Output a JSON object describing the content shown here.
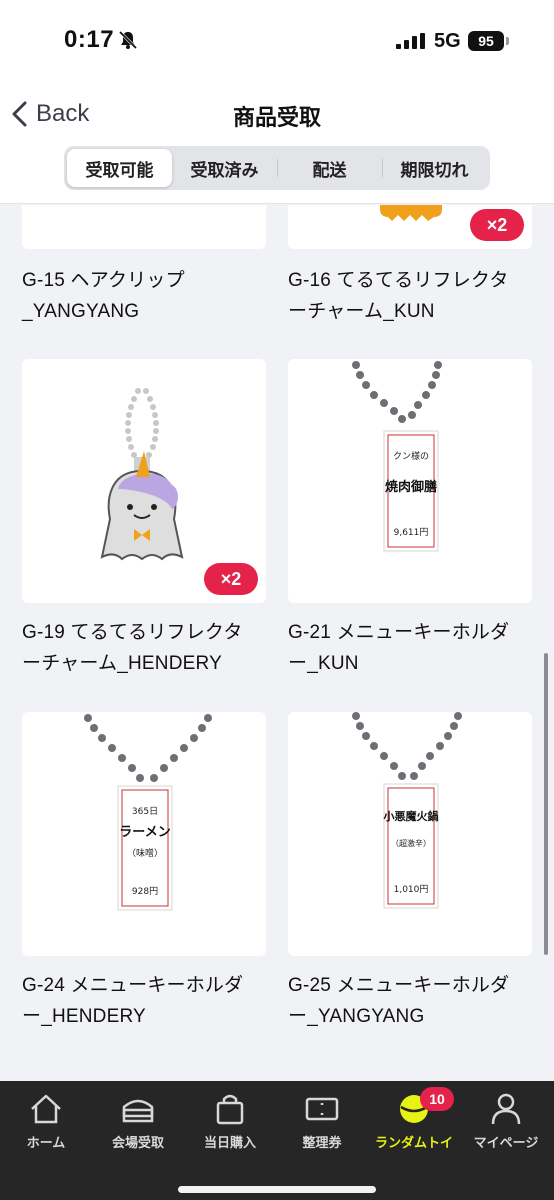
{
  "status_bar": {
    "time": "0:17",
    "network": "5G",
    "battery": "95"
  },
  "nav": {
    "back_label": "Back",
    "title": "商品受取"
  },
  "segments": [
    {
      "label": "受取可能",
      "active": true
    },
    {
      "label": "受取済み",
      "active": false
    },
    {
      "label": "配送",
      "active": false
    },
    {
      "label": "期限切れ",
      "active": false
    }
  ],
  "items": [
    {
      "caption": "G-15 ヘアクリップ\n_YANGYANG",
      "badge": ""
    },
    {
      "caption": "G-16 てるてるリフレクタ\nーチャーム_KUN",
      "badge": "×2"
    },
    {
      "caption": "G-19 てるてるリフレクタ\nーチャーム_HENDERY",
      "badge": "×2"
    },
    {
      "caption": "G-21 メニューキーホルダ\nー_KUN",
      "badge": "",
      "menu": {
        "top": "クン様の",
        "main": "焼肉御膳",
        "price": "9,611円"
      }
    },
    {
      "caption": "G-24 メニューキーホルダ\nー_HENDERY",
      "badge": "",
      "menu": {
        "top": "365日",
        "main": "ラーメン",
        "sub": "（味噌）",
        "price": "928円"
      }
    },
    {
      "caption": "G-25 メニューキーホルダ\nー_YANGYANG",
      "badge": "",
      "menu": {
        "main": "小悪魔火鍋",
        "sub": "（超激辛）",
        "price": "1,010円"
      }
    }
  ],
  "tabbar": {
    "tabs": [
      {
        "label": "ホーム",
        "icon": "home-icon",
        "active": false
      },
      {
        "label": "会場受取",
        "icon": "venue-icon",
        "active": false
      },
      {
        "label": "当日購入",
        "icon": "shopping-bag-icon",
        "active": false
      },
      {
        "label": "整理券",
        "icon": "ticket-icon",
        "active": false
      },
      {
        "label": "ランダムトイ",
        "icon": "random-toy-icon",
        "active": true,
        "badge": "10"
      },
      {
        "label": "マイページ",
        "icon": "person-icon",
        "active": false
      }
    ]
  },
  "colors": {
    "accent_yellow": "#e7f312",
    "badge_red": "#e5234a",
    "tabbar_bg": "#262626",
    "page_bg": "#f1f2f5"
  }
}
